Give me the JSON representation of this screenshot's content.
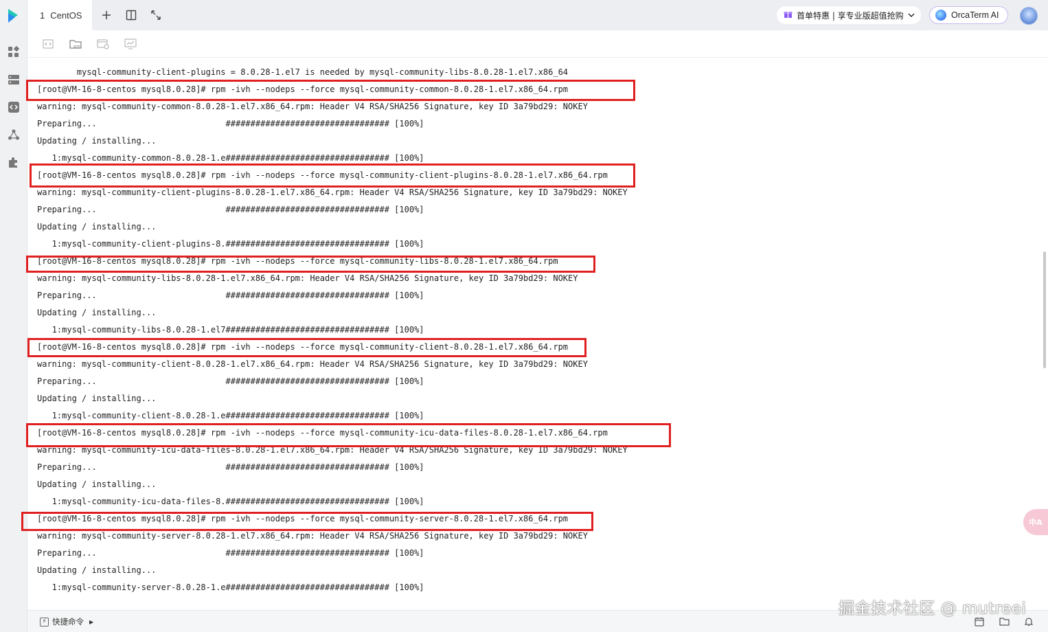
{
  "tab": {
    "number": "1",
    "title": "CentOS"
  },
  "promo": {
    "gift_icon": "gift-icon",
    "text": "首单特惠 | 享专业版超值抢购"
  },
  "ai_button": {
    "label": "OrcaTerm AI"
  },
  "terminal": {
    "lines": [
      "        mysql-community-client-plugins = 8.0.28-1.el7 is needed by mysql-community-libs-8.0.28-1.el7.x86_64",
      "[root@VM-16-8-centos mysql8.0.28]# rpm -ivh --nodeps --force mysql-community-common-8.0.28-1.el7.x86_64.rpm",
      "warning: mysql-community-common-8.0.28-1.el7.x86_64.rpm: Header V4 RSA/SHA256 Signature, key ID 3a79bd29: NOKEY",
      "Preparing...                          ################################# [100%]",
      "Updating / installing...",
      "   1:mysql-community-common-8.0.28-1.e################################# [100%]",
      "[root@VM-16-8-centos mysql8.0.28]# rpm -ivh --nodeps --force mysql-community-client-plugins-8.0.28-1.el7.x86_64.rpm",
      "warning: mysql-community-client-plugins-8.0.28-1.el7.x86_64.rpm: Header V4 RSA/SHA256 Signature, key ID 3a79bd29: NOKEY",
      "Preparing...                          ################################# [100%]",
      "Updating / installing...",
      "   1:mysql-community-client-plugins-8.################################# [100%]",
      "[root@VM-16-8-centos mysql8.0.28]# rpm -ivh --nodeps --force mysql-community-libs-8.0.28-1.el7.x86_64.rpm",
      "warning: mysql-community-libs-8.0.28-1.el7.x86_64.rpm: Header V4 RSA/SHA256 Signature, key ID 3a79bd29: NOKEY",
      "Preparing...                          ################################# [100%]",
      "Updating / installing...",
      "   1:mysql-community-libs-8.0.28-1.el7################################# [100%]",
      "[root@VM-16-8-centos mysql8.0.28]# rpm -ivh --nodeps --force mysql-community-client-8.0.28-1.el7.x86_64.rpm",
      "warning: mysql-community-client-8.0.28-1.el7.x86_64.rpm: Header V4 RSA/SHA256 Signature, key ID 3a79bd29: NOKEY",
      "Preparing...                          ################################# [100%]",
      "Updating / installing...",
      "   1:mysql-community-client-8.0.28-1.e################################# [100%]",
      "[root@VM-16-8-centos mysql8.0.28]# rpm -ivh --nodeps --force mysql-community-icu-data-files-8.0.28-1.el7.x86_64.rpm",
      "warning: mysql-community-icu-data-files-8.0.28-1.el7.x86_64.rpm: Header V4 RSA/SHA256 Signature, key ID 3a79bd29: NOKEY",
      "Preparing...                          ################################# [100%]",
      "Updating / installing...",
      "   1:mysql-community-icu-data-files-8.################################# [100%]",
      "[root@VM-16-8-centos mysql8.0.28]# rpm -ivh --nodeps --force mysql-community-server-8.0.28-1.el7.x86_64.rpm",
      "warning: mysql-community-server-8.0.28-1.el7.x86_64.rpm: Header V4 RSA/SHA256 Signature, key ID 3a79bd29: NOKEY",
      "Preparing...                          ################################# [100%]",
      "Updating / installing...",
      "   1:mysql-community-server-8.0.28-1.e################################# [100%]"
    ]
  },
  "highlight_color": "#e02020",
  "bottom": {
    "quick_commands": "快捷命令"
  },
  "translate_button": {
    "label": "中A"
  },
  "watermark": "掘金技术社区 @ mutreei"
}
